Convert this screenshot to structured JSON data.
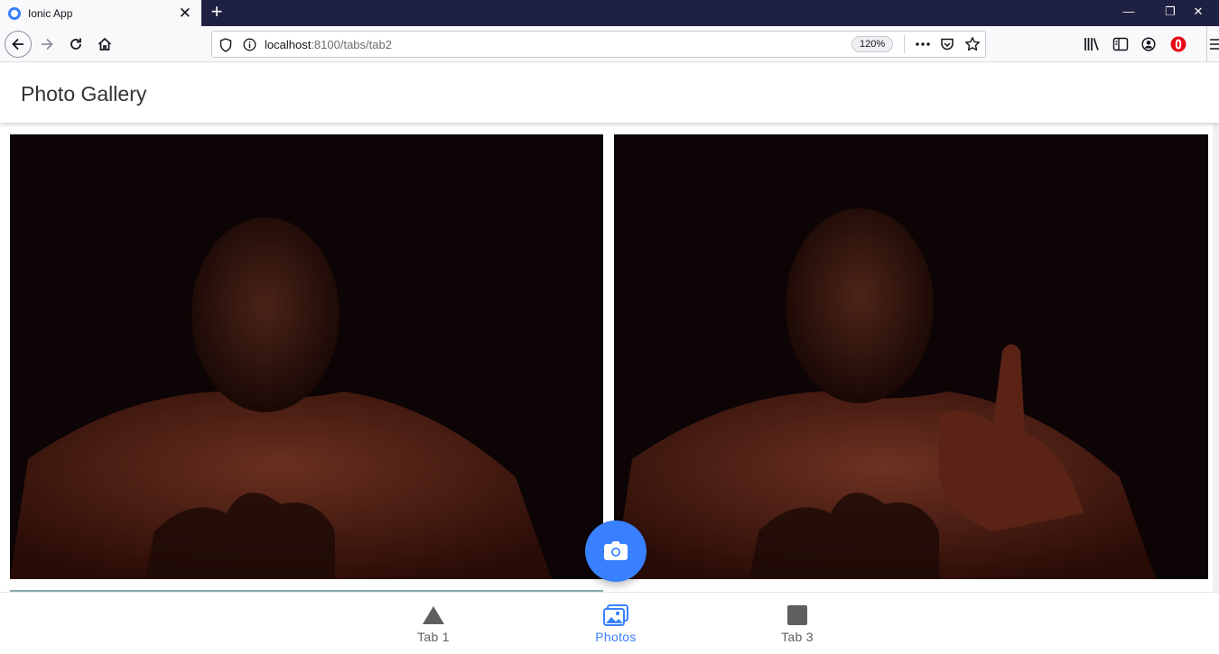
{
  "browser": {
    "tab_title": "Ionic App",
    "tab_close": "✕",
    "new_tab": "+",
    "window_minimize": "—",
    "window_restore": "❐",
    "window_close": "✕",
    "url_host": "localhost",
    "url_rest": ":8100/tabs/tab2",
    "zoom": "120%"
  },
  "app": {
    "title": "Photo Gallery"
  },
  "photos": [
    {
      "alt": "photo-1"
    },
    {
      "alt": "photo-2"
    }
  ],
  "tabbar": {
    "tabs": [
      {
        "label": "Tab 1",
        "icon": "triangle-icon"
      },
      {
        "label": "Photos",
        "icon": "images-icon",
        "active": true
      },
      {
        "label": "Tab 3",
        "icon": "square-icon"
      }
    ]
  },
  "colors": {
    "primary": "#3880ff",
    "tab_inactive": "#5f5f5f",
    "titlebar": "#1f2142"
  }
}
